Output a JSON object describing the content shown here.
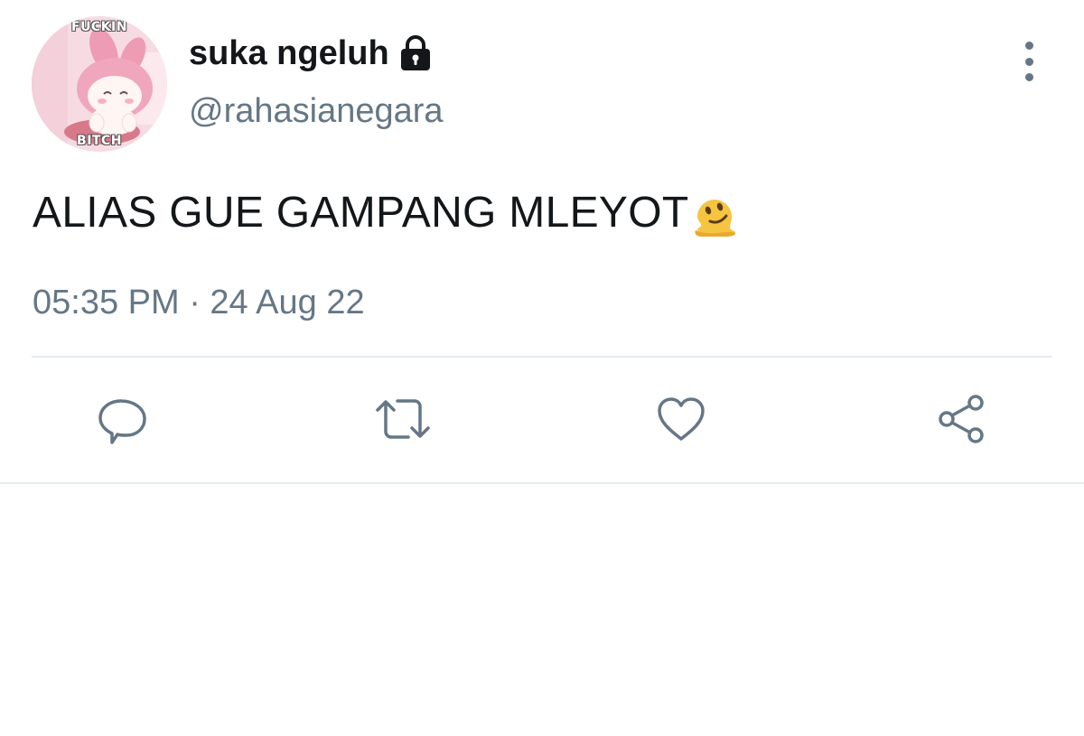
{
  "avatar": {
    "caption_top": "FUCKIN",
    "caption_bottom": "BITCH",
    "icon": "my-melody-avatar"
  },
  "user": {
    "display_name": "suka ngeluh",
    "handle": "@rahasianegara",
    "protected_icon": "lock-icon"
  },
  "tweet": {
    "text": "ALIAS GUE GAMPANG MLEYOT",
    "emoji": "melting-face-emoji",
    "timestamp": "05:35 PM · 24 Aug 22"
  },
  "menu_icon": "more-vertical-icon",
  "actions": [
    {
      "icon": "reply-icon"
    },
    {
      "icon": "retweet-icon"
    },
    {
      "icon": "like-icon"
    },
    {
      "icon": "share-icon"
    }
  ],
  "colors": {
    "text_primary": "#14171a",
    "text_secondary": "#657786",
    "divider": "#e6ecf0",
    "icon": "#657786"
  }
}
